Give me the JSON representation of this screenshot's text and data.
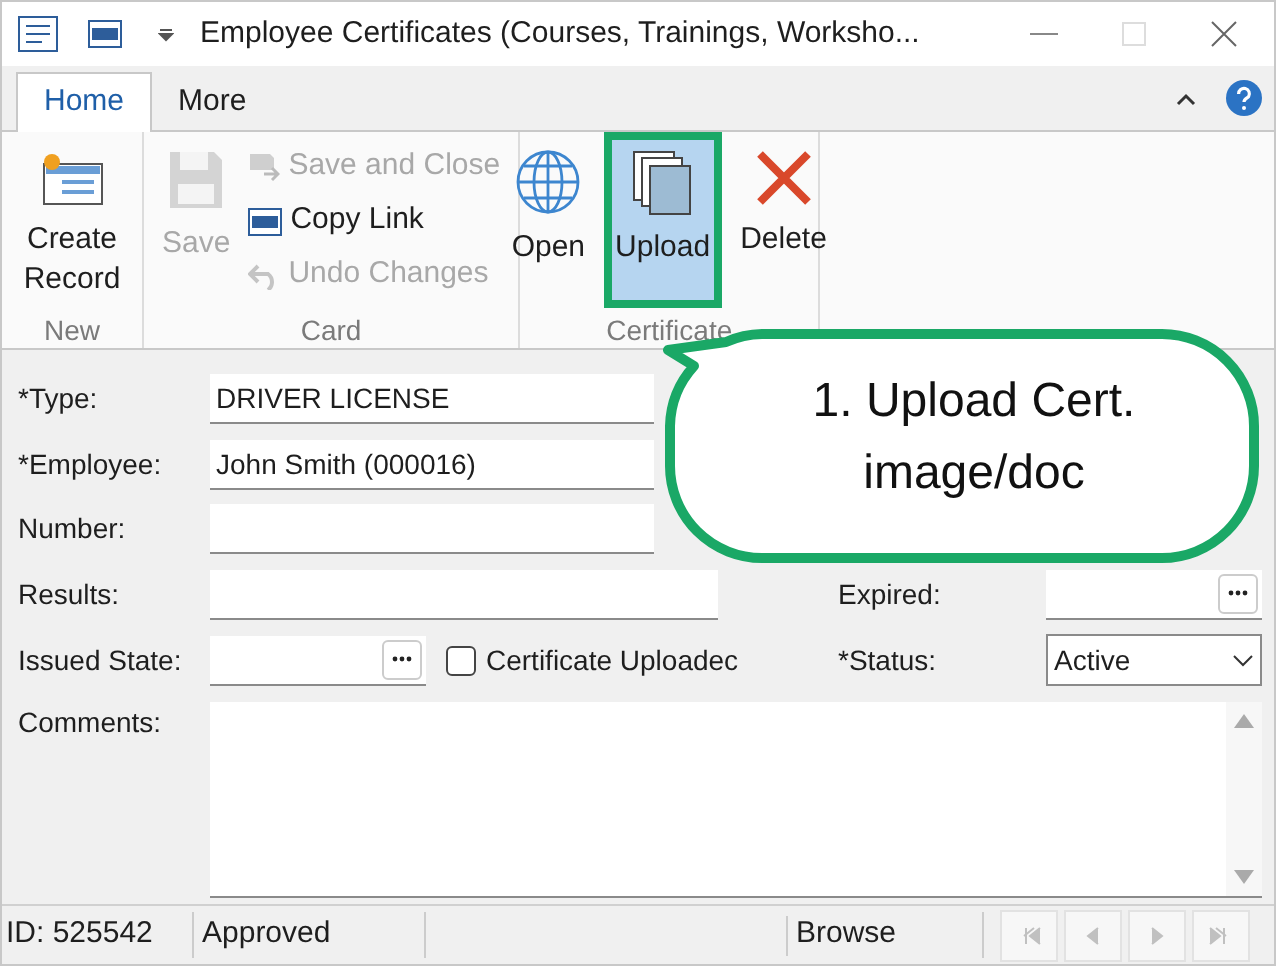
{
  "window": {
    "title": "Employee Certificates (Courses, Trainings, Worksho..."
  },
  "tabs": [
    {
      "label": "Home",
      "selected": true
    },
    {
      "label": "More",
      "selected": false
    }
  ],
  "ribbon": [
    {
      "label": "New",
      "items": [
        {
          "label": "Create Record",
          "kind": "large",
          "disabled": false,
          "highlighted": false
        }
      ]
    },
    {
      "label": "Card",
      "items": [
        {
          "label": "Save",
          "kind": "large",
          "disabled": true,
          "highlighted": false
        },
        {
          "label": "Save and Close",
          "kind": "small",
          "disabled": true,
          "highlighted": false
        },
        {
          "label": "Copy Link",
          "kind": "small",
          "disabled": false,
          "highlighted": false
        },
        {
          "label": "Undo Changes",
          "kind": "small",
          "disabled": true,
          "highlighted": false
        }
      ]
    },
    {
      "label": "Certificate",
      "items": [
        {
          "label": "Open",
          "kind": "large",
          "disabled": false,
          "highlighted": false
        },
        {
          "label": "Upload",
          "kind": "large",
          "disabled": false,
          "highlighted": true
        },
        {
          "label": "Delete",
          "kind": "large",
          "disabled": false,
          "highlighted": false
        }
      ]
    }
  ],
  "form": {
    "rows": [
      {
        "left": [
          {
            "label": "*Type:",
            "kind": "wide",
            "value": "DRIVER LICENSE"
          }
        ]
      },
      {
        "left": [
          {
            "label": "*Employee:",
            "kind": "wide",
            "value": "John Smith (000016)"
          }
        ]
      },
      {
        "left": [
          {
            "label": "Number:",
            "kind": "wide"
          }
        ]
      },
      {
        "left": [
          {
            "label": "Results:",
            "kind": "text"
          }
        ],
        "right": {
          "label": "Expired:",
          "kind": "lookup"
        }
      },
      {
        "left": [
          {
            "label": "Issued State:",
            "kind": "lookup"
          },
          {
            "label": "Certificate Uploadec",
            "kind": "checkbox",
            "checked": false
          }
        ],
        "right": {
          "label": "*Status:",
          "kind": "select",
          "value": "Active"
        }
      },
      {
        "left": [
          {
            "label": "Comments:",
            "kind": "memo"
          }
        ]
      }
    ]
  },
  "callout": {
    "lines": [
      "1. Upload Cert.",
      "image/doc"
    ]
  },
  "status_bar": {
    "id": "ID: 525542",
    "state": "Approved",
    "mode": "Browse"
  }
}
